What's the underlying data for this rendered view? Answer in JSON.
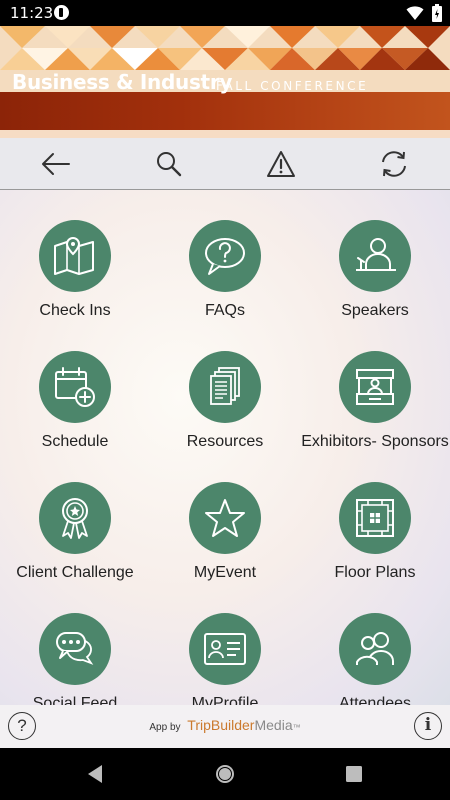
{
  "status_bar": {
    "time": "11:23"
  },
  "banner": {
    "title": "Business & Industry",
    "subtitle": "FALL CONFERENCE"
  },
  "toolbar": {
    "items": [
      {
        "icon": "back-arrow-icon"
      },
      {
        "icon": "search-icon"
      },
      {
        "icon": "alert-icon"
      },
      {
        "icon": "refresh-icon"
      }
    ]
  },
  "grid": {
    "items": [
      {
        "label": "Check Ins",
        "icon": "map-pin-icon"
      },
      {
        "label": "FAQs",
        "icon": "question-bubble-icon"
      },
      {
        "label": "Speakers",
        "icon": "speaker-icon"
      },
      {
        "label": "Schedule",
        "icon": "calendar-add-icon"
      },
      {
        "label": "Resources",
        "icon": "documents-icon"
      },
      {
        "label": "Exhibitors- Sponsors",
        "icon": "booth-icon"
      },
      {
        "label": "Client Challenge",
        "icon": "award-ribbon-icon"
      },
      {
        "label": "MyEvent",
        "icon": "star-icon"
      },
      {
        "label": "Floor Plans",
        "icon": "floor-plan-icon"
      },
      {
        "label": "Social Feed",
        "icon": "chat-bubbles-icon"
      },
      {
        "label": "MyProfile",
        "icon": "id-card-icon"
      },
      {
        "label": "Attendees",
        "icon": "people-icon"
      }
    ]
  },
  "footer": {
    "help": "?",
    "info": "i",
    "credit_prefix": "App by",
    "brand_part1": "TripBuilder",
    "brand_part2": "Media",
    "brand_mark": "™"
  },
  "colors": {
    "icon_bg": "#4c866b",
    "banner_strip": "#a2300c",
    "brand_orange": "#cb7a2e"
  }
}
